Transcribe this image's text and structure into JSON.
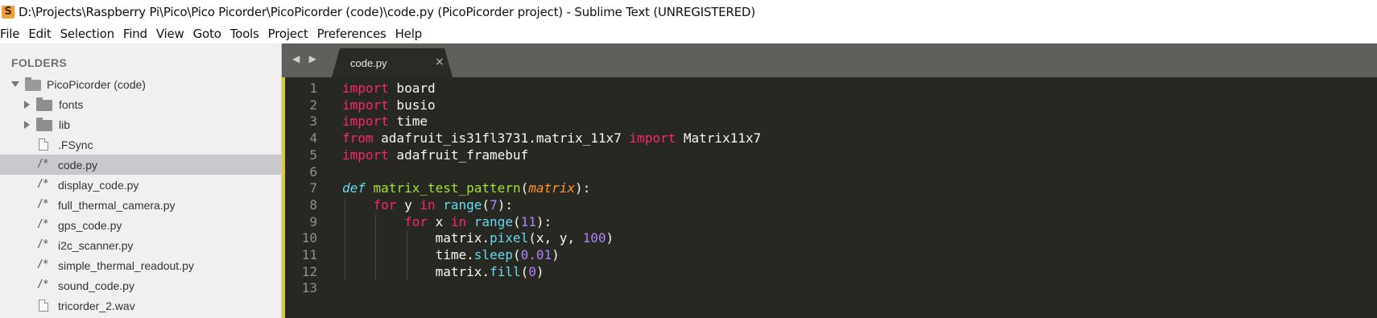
{
  "window": {
    "title": "D:\\Projects\\Raspberry Pi\\Pico\\Pico Picorder\\PicoPicorder (code)\\code.py (PicoPicorder project) - Sublime Text (UNREGISTERED)"
  },
  "menu": [
    "File",
    "Edit",
    "Selection",
    "Find",
    "View",
    "Goto",
    "Tools",
    "Project",
    "Preferences",
    "Help"
  ],
  "sidebar": {
    "header": "FOLDERS",
    "root": "PicoPicorder (code)",
    "items": [
      {
        "label": "fonts",
        "type": "folder"
      },
      {
        "label": "lib",
        "type": "folder"
      },
      {
        "label": ".FSync",
        "type": "file"
      },
      {
        "label": "code.py",
        "type": "source",
        "selected": true
      },
      {
        "label": "display_code.py",
        "type": "source"
      },
      {
        "label": "full_thermal_camera.py",
        "type": "source"
      },
      {
        "label": "gps_code.py",
        "type": "source"
      },
      {
        "label": "i2c_scanner.py",
        "type": "source"
      },
      {
        "label": "simple_thermal_readout.py",
        "type": "source"
      },
      {
        "label": "sound_code.py",
        "type": "source"
      },
      {
        "label": "tricorder_2.wav",
        "type": "file"
      }
    ],
    "source_icon_glyph": "/*"
  },
  "tabs": [
    {
      "label": "code.py",
      "close": "×",
      "active": true
    }
  ],
  "nav_arrows": "◀ ▶",
  "editor": {
    "line_numbers": [
      "1",
      "2",
      "3",
      "4",
      "5",
      "6",
      "7",
      "8",
      "9",
      "10",
      "11",
      "12",
      "13"
    ],
    "lines": [
      {
        "tokens": [
          {
            "t": "import",
            "c": "kw"
          },
          {
            "t": " board",
            "c": "plain"
          }
        ]
      },
      {
        "tokens": [
          {
            "t": "import",
            "c": "kw"
          },
          {
            "t": " busio",
            "c": "plain"
          }
        ]
      },
      {
        "tokens": [
          {
            "t": "import",
            "c": "kw"
          },
          {
            "t": " time",
            "c": "plain"
          }
        ]
      },
      {
        "tokens": [
          {
            "t": "from",
            "c": "kw"
          },
          {
            "t": " adafruit_is31fl3731.matrix_11x7 ",
            "c": "plain"
          },
          {
            "t": "import",
            "c": "kw"
          },
          {
            "t": " Matrix11x7",
            "c": "plain"
          }
        ]
      },
      {
        "tokens": [
          {
            "t": "import",
            "c": "kw"
          },
          {
            "t": " adafruit_framebuf",
            "c": "plain"
          }
        ]
      },
      {
        "tokens": []
      },
      {
        "tokens": [
          {
            "t": "def",
            "c": "def"
          },
          {
            "t": " ",
            "c": "plain"
          },
          {
            "t": "matrix_test_pattern",
            "c": "fn"
          },
          {
            "t": "(",
            "c": "plain"
          },
          {
            "t": "matrix",
            "c": "param"
          },
          {
            "t": "):",
            "c": "plain"
          }
        ]
      },
      {
        "tokens": [
          {
            "t": "    ",
            "c": "plain"
          },
          {
            "t": "for",
            "c": "kw"
          },
          {
            "t": " y ",
            "c": "plain"
          },
          {
            "t": "in",
            "c": "kw"
          },
          {
            "t": " ",
            "c": "plain"
          },
          {
            "t": "range",
            "c": "call"
          },
          {
            "t": "(",
            "c": "plain"
          },
          {
            "t": "7",
            "c": "num"
          },
          {
            "t": "):",
            "c": "plain"
          }
        ]
      },
      {
        "tokens": [
          {
            "t": "        ",
            "c": "plain"
          },
          {
            "t": "for",
            "c": "kw"
          },
          {
            "t": " x ",
            "c": "plain"
          },
          {
            "t": "in",
            "c": "kw"
          },
          {
            "t": " ",
            "c": "plain"
          },
          {
            "t": "range",
            "c": "call"
          },
          {
            "t": "(",
            "c": "plain"
          },
          {
            "t": "11",
            "c": "num"
          },
          {
            "t": "):",
            "c": "plain"
          }
        ]
      },
      {
        "tokens": [
          {
            "t": "            matrix.",
            "c": "plain"
          },
          {
            "t": "pixel",
            "c": "call"
          },
          {
            "t": "(x, y, ",
            "c": "plain"
          },
          {
            "t": "100",
            "c": "num"
          },
          {
            "t": ")",
            "c": "plain"
          }
        ]
      },
      {
        "tokens": [
          {
            "t": "            time.",
            "c": "plain"
          },
          {
            "t": "sleep",
            "c": "call"
          },
          {
            "t": "(",
            "c": "plain"
          },
          {
            "t": "0.01",
            "c": "num"
          },
          {
            "t": ")",
            "c": "plain"
          }
        ]
      },
      {
        "tokens": [
          {
            "t": "            matrix.",
            "c": "plain"
          },
          {
            "t": "fill",
            "c": "call"
          },
          {
            "t": "(",
            "c": "plain"
          },
          {
            "t": "0",
            "c": "num"
          },
          {
            "t": ")",
            "c": "plain"
          }
        ]
      },
      {
        "tokens": []
      }
    ]
  },
  "colors": {
    "editor_bg": "#272822",
    "keyword": "#f92672",
    "function": "#a6e22e",
    "builtin": "#66d9ef",
    "number": "#ae81ff",
    "parameter": "#fd971f",
    "modified_marker": "#d8cc2c"
  }
}
